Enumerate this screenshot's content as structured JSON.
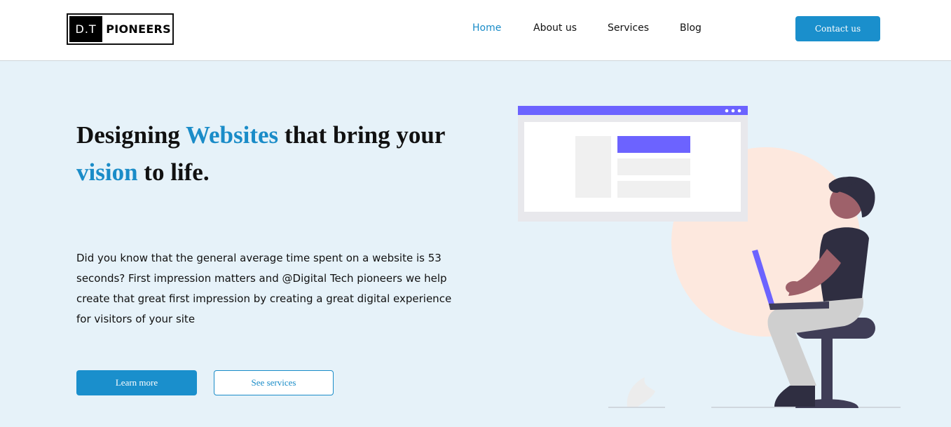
{
  "header": {
    "logo": {
      "box_text": "D.T",
      "text": "PIONEERS"
    },
    "nav": [
      {
        "label": "Home",
        "active": true
      },
      {
        "label": "About us",
        "active": false
      },
      {
        "label": "Services",
        "active": false
      },
      {
        "label": "Blog",
        "active": false
      }
    ],
    "contact_label": "Contact us"
  },
  "hero": {
    "headline": {
      "part1": "Designing ",
      "accent1": "Websites",
      "part2": " that bring your",
      "accent2": "vision",
      "part3": " to life."
    },
    "paragraph": "Did you know that the general average time spent on a website is 53 seconds? First impression matters and @Digital Tech pioneers we help create that great first impression by creating a great digital experience for visitors of your site",
    "learn_more_label": "Learn more",
    "see_services_label": "See services"
  },
  "colors": {
    "accent": "#1a8cc8",
    "background": "#e6f2f9",
    "illustration_purple": "#6c63ff",
    "circle": "#fde4d8"
  }
}
